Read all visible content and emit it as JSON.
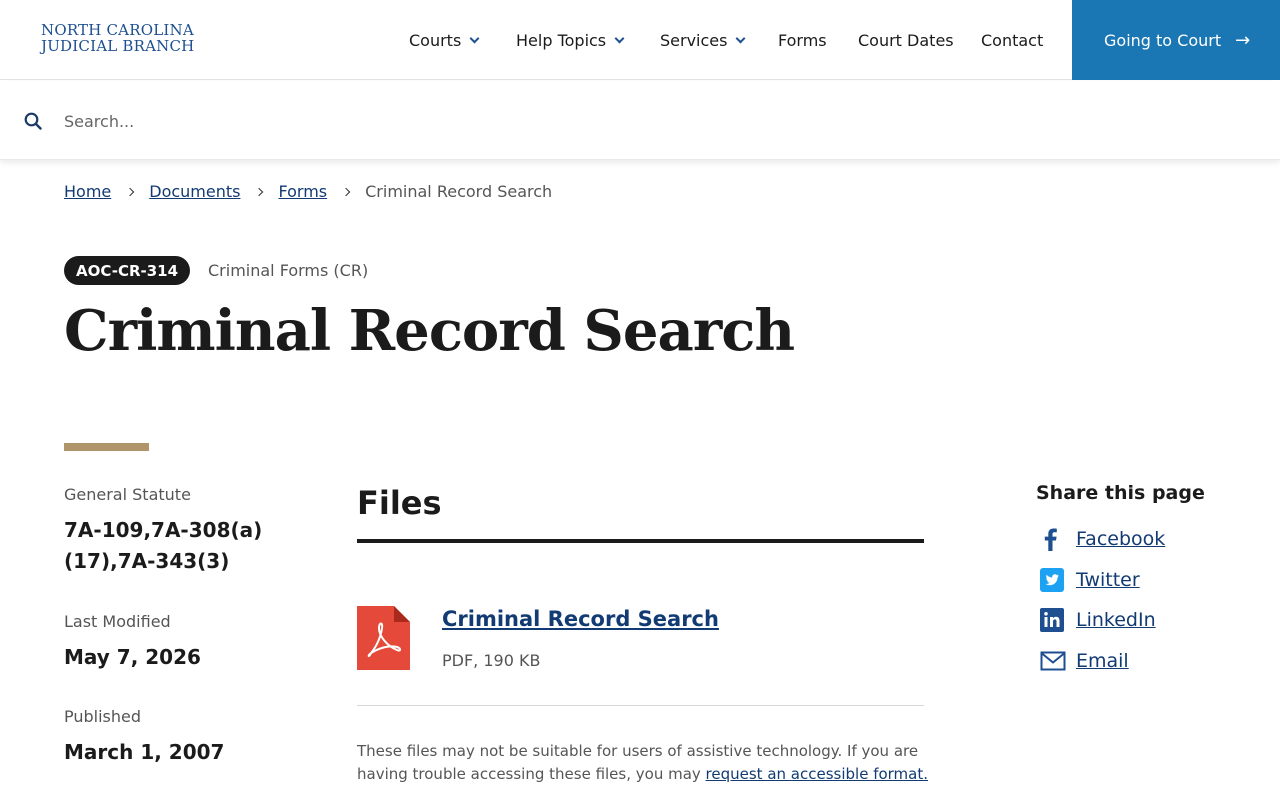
{
  "header": {
    "logo_line1": "NORTH CAROLINA",
    "logo_line2": "JUDICIAL BRANCH",
    "nav": [
      {
        "label": "Courts"
      },
      {
        "label": "Help Topics"
      },
      {
        "label": "Services"
      },
      {
        "label": "Forms"
      },
      {
        "label": "Court Dates"
      },
      {
        "label": "Contact"
      }
    ],
    "cta_label": "Going to Court",
    "cta_arrow": "→"
  },
  "search": {
    "placeholder": "Search..."
  },
  "breadcrumb": {
    "items": [
      "Home",
      "Documents",
      "Forms"
    ],
    "current": "Criminal Record Search"
  },
  "document": {
    "badge": "AOC-CR-314",
    "category": "Criminal Forms (CR)",
    "title": "Criminal Record Search"
  },
  "meta": {
    "statute_label": "General Statute",
    "statute_value": "7A-109,7A-308(a)(17),7A-343(3)",
    "modified_label": "Last Modified",
    "modified_value": "May 7, 2026",
    "published_label": "Published",
    "published_value": "March 1, 2007"
  },
  "files": {
    "heading": "Files",
    "items": [
      {
        "name": "Criminal Record Search",
        "meta": "PDF, 190 KB",
        "icon": "pdf-icon"
      }
    ],
    "note_text": "These files may not be suitable for users of assistive technology. If you are having trouble accessing these files, you may ",
    "note_link": "request an accessible format."
  },
  "share": {
    "heading": "Share this page",
    "items": [
      {
        "label": "Facebook",
        "icon": "facebook-icon"
      },
      {
        "label": "Twitter",
        "icon": "twitter-icon"
      },
      {
        "label": "LinkedIn",
        "icon": "linkedin-icon"
      },
      {
        "label": "Email",
        "icon": "email-icon"
      }
    ]
  },
  "colors": {
    "brand_blue": "#1d4f91",
    "cta_blue": "#1a77b4",
    "link": "#123b73",
    "accent_gold": "#b0956b",
    "pdf_red": "#e5493a"
  }
}
